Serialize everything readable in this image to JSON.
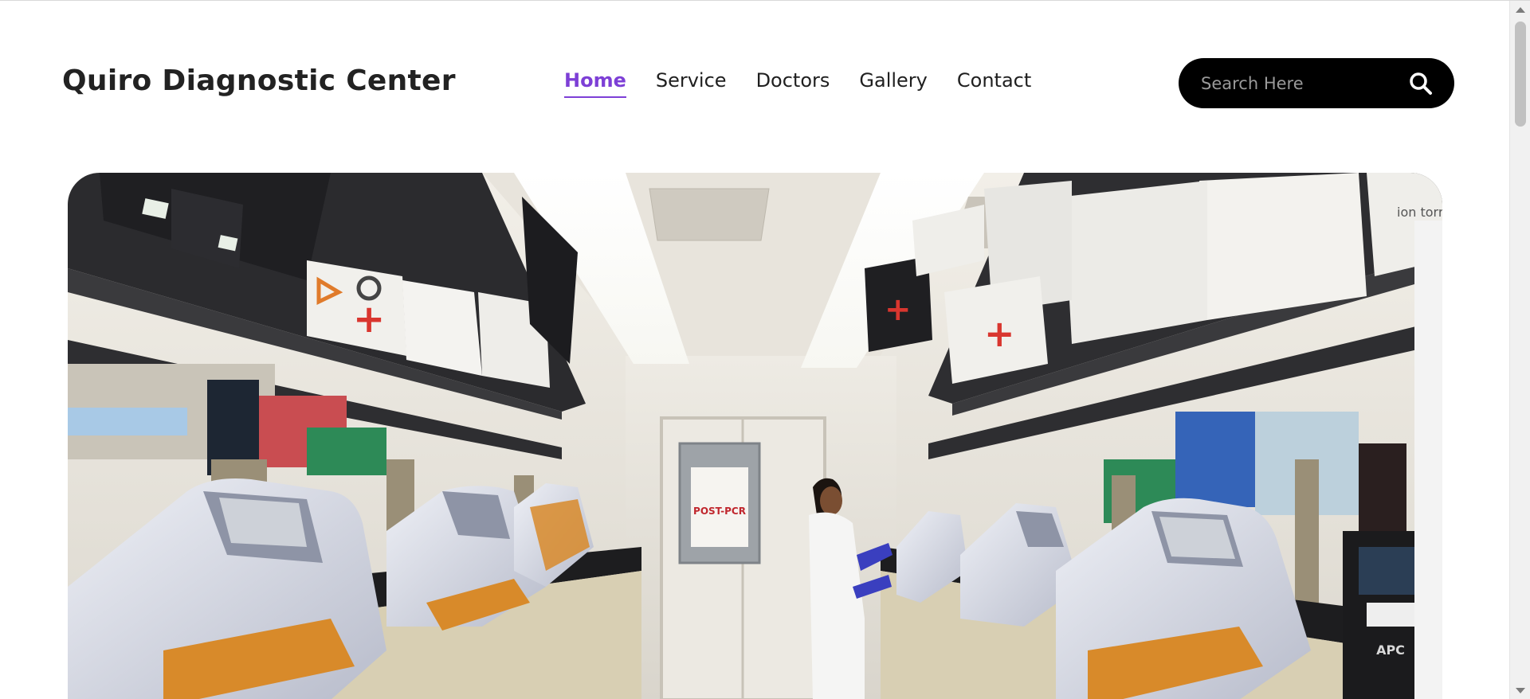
{
  "header": {
    "brand": "Quiro Diagnostic Center",
    "nav": [
      {
        "label": "Home",
        "active": true
      },
      {
        "label": "Service",
        "active": false
      },
      {
        "label": "Doctors",
        "active": false
      },
      {
        "label": "Gallery",
        "active": false
      },
      {
        "label": "Contact",
        "active": false
      }
    ],
    "search": {
      "placeholder": "Search Here",
      "icon": "search-icon"
    }
  },
  "hero": {
    "image": "laboratory-photo",
    "poster_text": "POST-PCR",
    "device_brand": "APC",
    "box_brand": "ion torrent"
  },
  "colors": {
    "accent": "#7d3fd6",
    "search_bg": "#000000",
    "text": "#1f1f1f"
  }
}
